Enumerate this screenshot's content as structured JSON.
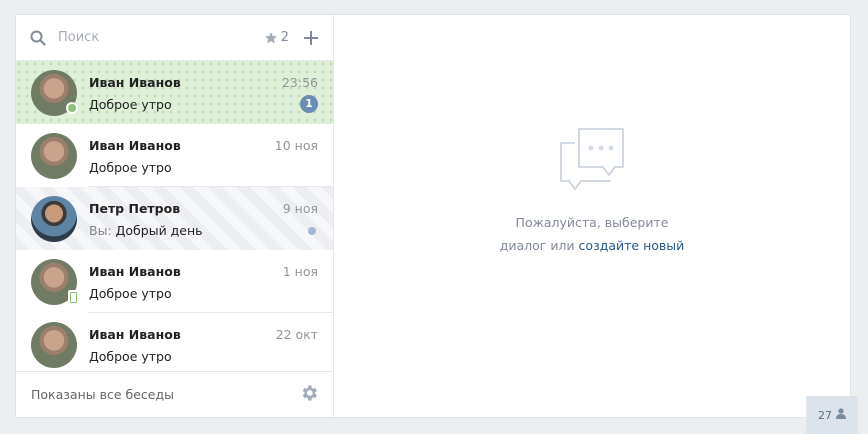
{
  "search": {
    "placeholder": "Поиск"
  },
  "favorites": {
    "count": "2"
  },
  "dialogs": [
    {
      "name": "Иван Иванов",
      "time": "23:56",
      "prefix": "",
      "message": "Доброе утро",
      "unread_count": "1",
      "state": "unread",
      "presence": "online"
    },
    {
      "name": "Иван Иванов",
      "time": "10 ноя",
      "prefix": "",
      "message": "Доброе утро",
      "unread_count": "",
      "state": "read",
      "presence": ""
    },
    {
      "name": "Петр Петров",
      "time": "9 ноя",
      "prefix": "Вы:",
      "message": "Добрый день",
      "unread_count": "",
      "state": "outgoing-unread",
      "presence": ""
    },
    {
      "name": "Иван Иванов",
      "time": "1 ноя",
      "prefix": "",
      "message": "Доброе утро",
      "unread_count": "",
      "state": "read",
      "presence": "mobile"
    },
    {
      "name": "Иван Иванов",
      "time": "22 окт",
      "prefix": "",
      "message": "Доброе утро",
      "unread_count": "",
      "state": "read",
      "presence": ""
    }
  ],
  "footer": {
    "status": "Показаны все беседы"
  },
  "empty_state": {
    "line1": "Пожалуйста, выберите",
    "line2_prefix": "диалог или",
    "line2_link": "создайте новый"
  },
  "online_counter": {
    "count": "27"
  },
  "colors": {
    "unread_bg": "#dff0d8",
    "badge": "#6b8db5",
    "link": "#2a5885",
    "online": "#8ac176"
  }
}
